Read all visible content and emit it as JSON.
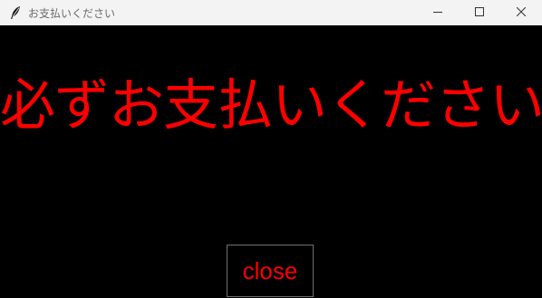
{
  "window": {
    "title": "お支払いください",
    "icon": "feather-icon",
    "controls": [
      "minimize-icon",
      "maximize-icon",
      "close-icon"
    ]
  },
  "content": {
    "message": "必ずお支払いください",
    "close_button_label": "close"
  },
  "colors": {
    "background": "#000000",
    "text": "#ff0000",
    "titlebar": "#f3f3f3"
  }
}
